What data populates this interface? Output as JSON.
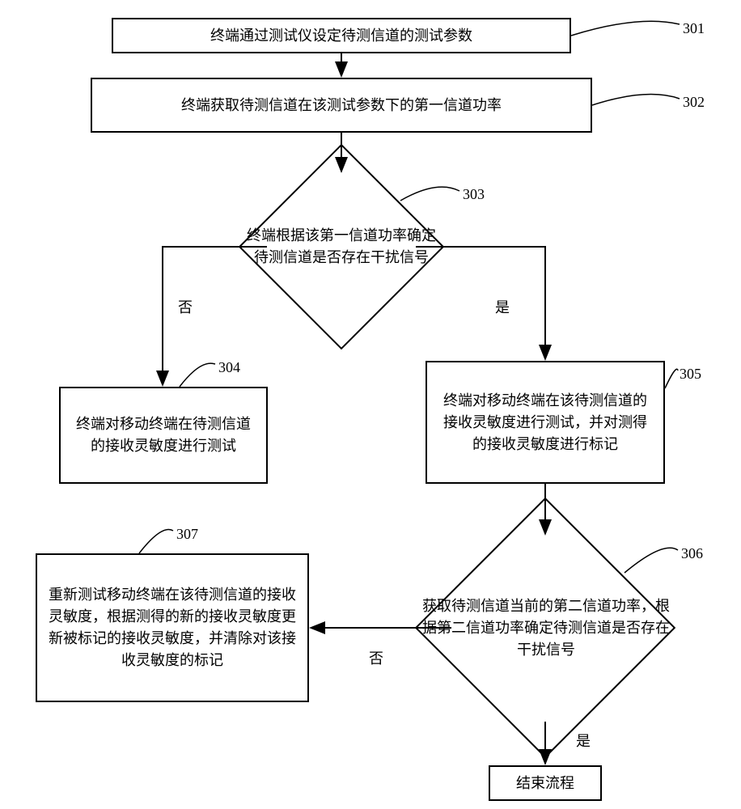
{
  "nodes": {
    "n301": {
      "text": "终端通过测试仪设定待测信道的测试参数",
      "num": "301"
    },
    "n302": {
      "text": "终端获取待测信道在该测试参数下的第一信道功率",
      "num": "302"
    },
    "n303": {
      "text": "终端根据该第一信道功率确定待测信道是否存在干扰信号",
      "num": "303"
    },
    "n304": {
      "text": "终端对移动终端在待测信道的接收灵敏度进行测试",
      "num": "304"
    },
    "n305": {
      "text": "终端对移动终端在该待测信道的接收灵敏度进行测试，并对测得的接收灵敏度进行标记",
      "num": "305"
    },
    "n306": {
      "text": "获取待测信道当前的第二信道功率，根据第二信道功率确定待测信道是否存在干扰信号",
      "num": "306"
    },
    "n307": {
      "text": "重新测试移动终端在该待测信道的接收灵敏度，根据测得的新的接收灵敏度更新被标记的接收灵敏度，并清除对该接收灵敏度的标记",
      "num": "307"
    },
    "end": {
      "text": "结束流程"
    }
  },
  "branches": {
    "no": "否",
    "yes": "是"
  }
}
